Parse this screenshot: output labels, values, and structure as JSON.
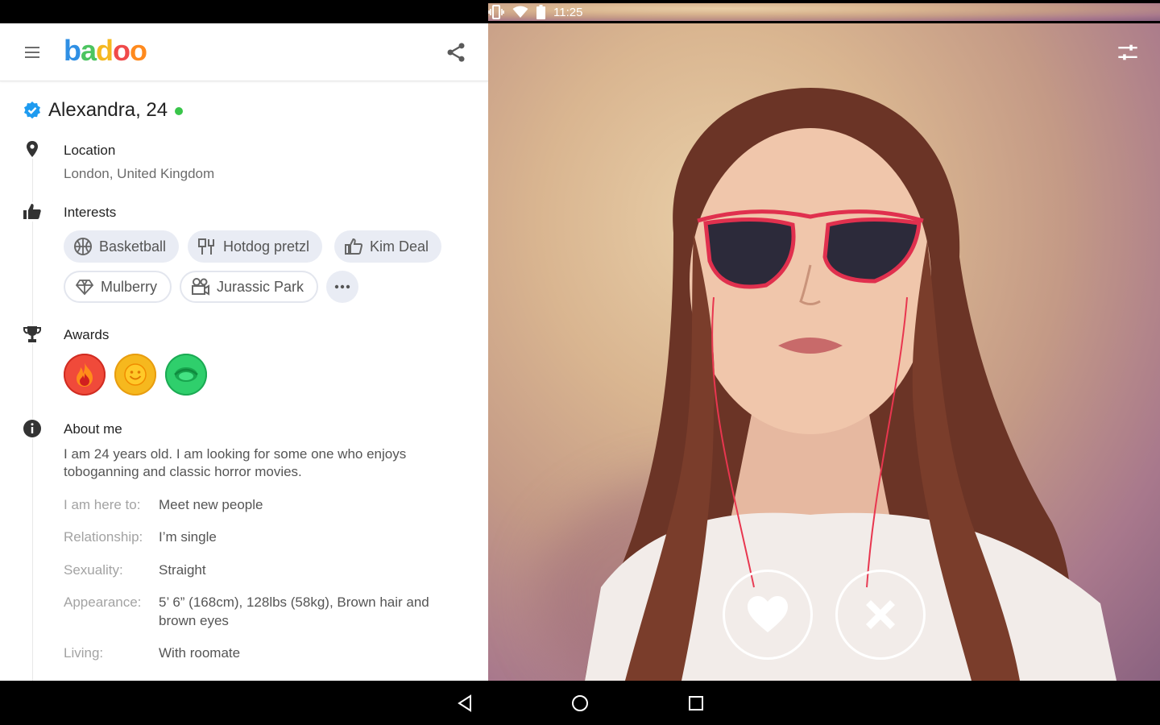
{
  "status": {
    "time": "11:25"
  },
  "header": {
    "logo_letters": [
      {
        "ch": "b",
        "color": "#2f8fe4"
      },
      {
        "ch": "a",
        "color": "#4cc460"
      },
      {
        "ch": "d",
        "color": "#f5b820"
      },
      {
        "ch": "o",
        "color": "#f04a4a"
      },
      {
        "ch": "o",
        "color": "#ff8a1e"
      }
    ]
  },
  "profile": {
    "name": "Alexandra, 24",
    "verified_color": "#1e9bf0",
    "online_color": "#39c54a"
  },
  "location": {
    "title": "Location",
    "value": "London, United Kingdom"
  },
  "interests": {
    "title": "Interests",
    "items": [
      {
        "label": "Basketball",
        "icon": "basketball-icon"
      },
      {
        "label": "Hotdog pretzl",
        "icon": "fork-knife-icon"
      },
      {
        "label": "Kim Deal",
        "icon": "thumbs-up-icon"
      },
      {
        "label": "Mulberry",
        "icon": "diamond-icon"
      },
      {
        "label": "Jurassic Park",
        "icon": "movie-camera-icon"
      }
    ]
  },
  "awards": {
    "title": "Awards",
    "items": [
      {
        "icon": "fire-icon",
        "color": "#f04a3a"
      },
      {
        "icon": "smiley-icon",
        "color": "#f6b81e"
      },
      {
        "icon": "eye-icon",
        "color": "#2fcf6c"
      }
    ]
  },
  "about": {
    "title": "About me",
    "text_line1": "I am 24 years old. I am looking for some one who enjoys",
    "text_line2": "toboganning and classic horror movies.",
    "fields": [
      {
        "label": "I am here to:",
        "value": "Meet new people"
      },
      {
        "label": "Relationship:",
        "value": "I’m single"
      },
      {
        "label": "Sexuality:",
        "value": "Straight"
      },
      {
        "label": "Appearance:",
        "value": "5’ 6” (168cm), 128lbs (58kg), Brown hair and brown eyes"
      },
      {
        "label": "Living:",
        "value": "With roomate"
      }
    ]
  }
}
